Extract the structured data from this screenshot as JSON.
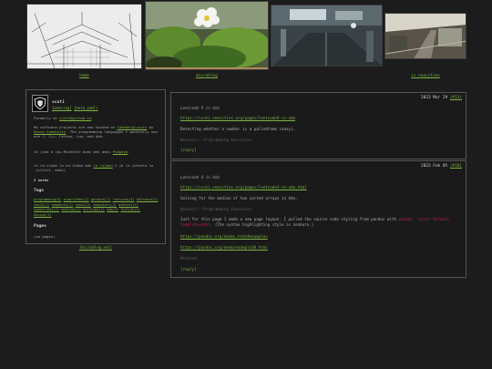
{
  "nav": {
    "tiles": [
      {
        "caption": "home",
        "scene": "pagoda-sketch"
      },
      {
        "caption": "microblog",
        "scene": "strawberry-flower"
      },
      {
        "caption": "",
        "scene": "industrial-interior"
      },
      {
        "caption": "is neocities",
        "scene": "train-station"
      }
    ]
  },
  "sidebar": {
    "name": "scuti",
    "links": [
      "[webring]",
      "[meta.yaml]"
    ],
    "formerly_prefix": "Formerly at ",
    "formerly_link": "scuti@github.io",
    "formerly_suffix": ".",
    "bio_1_a": "My software projects are now hosted on ",
    "bio_1_link_a": "Codeberg/scuti",
    "bio_1_b": " by ",
    "bio_1_link_b": "Renzo Community",
    "bio_1_c": ". The programming languages I generally use are C, C++, Python, Lua, and Ada.",
    "bio_2_a": "Je joue à (au Minetest avec mes amis ",
    "bio_2_link": "Pidgeyb",
    "bio_2_b": ".",
    "bio_3_a": "ro ra cinba lo ka'itaba kan ",
    "bio_3_link": "la lojban",
    "bio_3_b": ".i je le jufnefa le .lilitit. mumi)",
    "notes_count": "2 notes",
    "tags_heading": "Tags",
    "tags": [
      "programming(6)",
      "algorithms(1)",
      "gardens(1)",
      "lectures(4)",
      "software(2)",
      "tools(1)",
      "adagents(1)",
      "howto(2)",
      "computers(2)",
      "arbtest(1)",
      "hyperlinks(1)",
      "bestias(1)",
      "writings(1)",
      "ada(2)",
      "fortran(1)",
      "design(1)"
    ],
    "pages_heading": "Pages",
    "pages_value": "(no pages)",
    "microblog_link": "[microblog.xml]"
  },
  "posts": [
    {
      "date": "2023 Mar 29",
      "permalink": "(#13)",
      "title": "Leetcode 9 in Ada",
      "url": "https://scuti.neocities.org/pages/leetcode9-in-ada",
      "paragraphs": [
        {
          "text": "Detecting whether a number is a palindrome (easy)."
        }
      ],
      "tags": "Notes(s): Programming Exercises",
      "reply": "[reply]"
    },
    {
      "date": "2023 Feb 05",
      "permalink": "(#10)",
      "title": "Leetcode 4 in Ada",
      "url": "https://scuti.neocities.org/pages/leetcode4-in-ada.html",
      "paragraphs": [
        {
          "text": "Solving for the median of two sorted arrays in Ada."
        }
      ],
      "tags": "Notes(s): Programming Exercises",
      "extra_text_a": "Just for this page I made a new page layout. I pulled the source code styling from pandoc with ",
      "extra_code": "pandoc --print-default-template=html",
      "extra_text_b": ". (The syntax highlighting style is zenburn.)",
      "links": [
        "https://pandoc.org/demos.html#examples",
        "https://pandoc.org/demo/example30.html"
      ],
      "trailing_muted": "Weekend",
      "reply": "[reply]"
    }
  ]
}
